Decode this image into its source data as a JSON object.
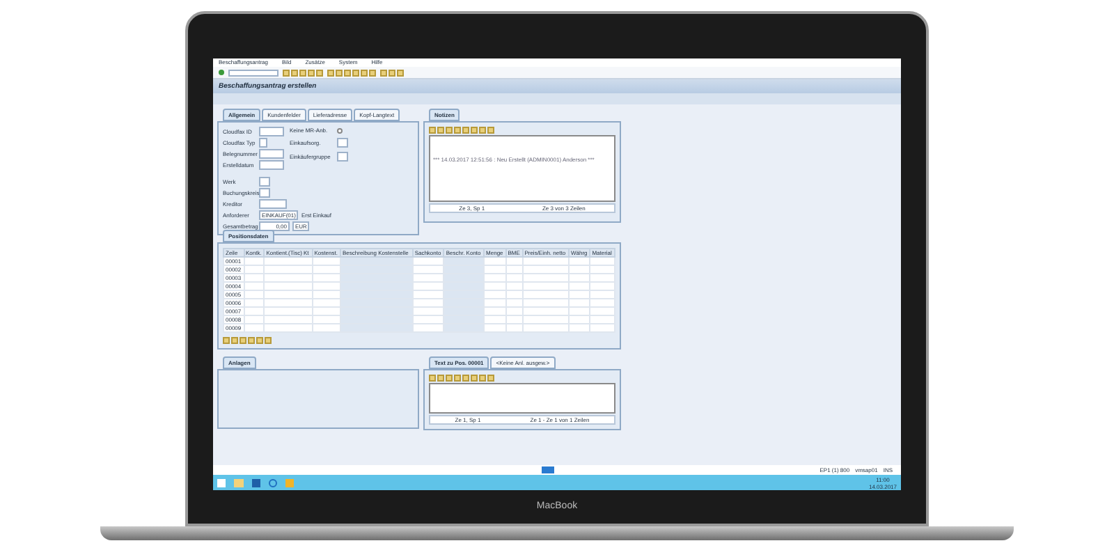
{
  "menu": [
    "Beschaffungsantrag",
    "Bild",
    "Zusätze",
    "System",
    "Hilfe"
  ],
  "title": "Beschaffungsantrag erstellen",
  "header_tabs": [
    {
      "label": "Allgemein",
      "selected": true
    },
    {
      "label": "Kundenfelder",
      "selected": false
    },
    {
      "label": "Lieferadresse",
      "selected": false
    },
    {
      "label": "Kopf-Langtext",
      "selected": false
    }
  ],
  "fields_left": [
    {
      "label": "Cloudfax ID",
      "kind": "wide"
    },
    {
      "label": "Cloudfax Typ",
      "kind": "small"
    },
    {
      "label": "Belegnummer",
      "kind": "wide"
    },
    {
      "label": "Erstelldatum",
      "kind": "wide"
    }
  ],
  "fields_right": [
    {
      "label": "Keine MR-Anb.",
      "kind": "radio",
      "checked": false
    },
    {
      "label": "Einkaufsorg.",
      "kind": "field"
    },
    {
      "label": "Einkäufergruppe",
      "kind": "field"
    }
  ],
  "fields_mid": [
    {
      "label": "Werk",
      "kind": "small"
    },
    {
      "label": "Buchungskreis",
      "kind": "small"
    },
    {
      "label": "Kreditor",
      "kind": "wide"
    }
  ],
  "requester": {
    "label": "Anforderer",
    "value": "EINKAUF(01)",
    "note": "Erst Einkauf"
  },
  "total": {
    "label": "Gesamtbetrag",
    "value": "0,00",
    "currency": "EUR"
  },
  "notes": {
    "tab": "Notizen",
    "text": "*** 14.03.2017 12:51:56 : Neu Erstellt (ADMIN0001) Anderson ***",
    "status": [
      "Ze 3, Sp 1",
      "Ze 3 von 3 Zeilen"
    ]
  },
  "items": {
    "tab": "Positionsdaten",
    "columns": [
      {
        "label": "Zeile",
        "shaded": false
      },
      {
        "label": "Kontk.",
        "shaded": false
      },
      {
        "label": "Kontient.(Tisc) Kt",
        "shaded": false
      },
      {
        "label": "Kostenst.",
        "shaded": false
      },
      {
        "label": "Beschreibung Kostenstelle",
        "shaded": true
      },
      {
        "label": "Sachkonto",
        "shaded": false
      },
      {
        "label": "Beschr. Konto",
        "shaded": true
      },
      {
        "label": "Menge",
        "shaded": false
      },
      {
        "label": "BME",
        "shaded": false
      },
      {
        "label": "Preis/Einh. netto",
        "shaded": false
      },
      {
        "label": "Währg",
        "shaded": false
      },
      {
        "label": "Material",
        "shaded": false
      }
    ],
    "rows": [
      "00001",
      "00002",
      "00003",
      "00004",
      "00005",
      "00006",
      "00007",
      "00008",
      "00009"
    ]
  },
  "attachments": {
    "tab": "Anlagen"
  },
  "item_text": {
    "tabs": [
      {
        "label": "Text zu Pos. 00001",
        "selected": true
      },
      {
        "label": "<Keine Anl. ausgew.>",
        "selected": false
      }
    ],
    "status": [
      "Ze 1, Sp 1",
      "Ze 1 - Ze 1 von 1 Zeilen"
    ]
  },
  "status_bar": {
    "system": "EP1 (1) 800",
    "server": "vmsap01",
    "mode": "INS"
  },
  "clock": {
    "time": "11:00",
    "date": "14.03.2017"
  },
  "device_label": "MacBook"
}
